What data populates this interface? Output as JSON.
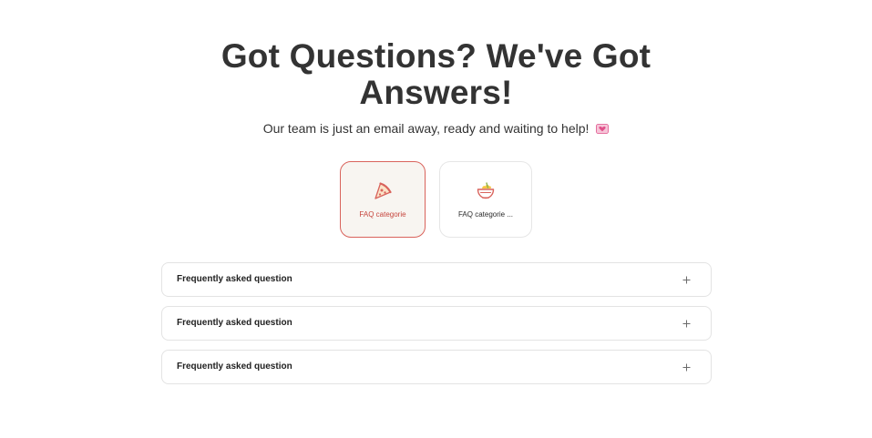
{
  "hero": {
    "title_line1": "Got Questions? We've Got",
    "title_line2": "Answers!",
    "subtitle": "Our team is just an email away, ready and waiting to help!",
    "subtitle_icon": "heart-icon"
  },
  "categories": [
    {
      "label": "FAQ categorie",
      "icon": "pizza-slice-icon",
      "active": true
    },
    {
      "label": "FAQ categorie ...",
      "icon": "bowl-icon",
      "active": false
    }
  ],
  "faqs": [
    {
      "question": "Frequently asked question",
      "toggle_icon": "plus-icon"
    },
    {
      "question": "Frequently asked question",
      "toggle_icon": "plus-icon"
    },
    {
      "question": "Frequently asked question",
      "toggle_icon": "plus-icon"
    }
  ],
  "colors": {
    "accent": "#d9635c",
    "active_card_bg": "#f8f5f1",
    "heart": "#e0508a"
  }
}
